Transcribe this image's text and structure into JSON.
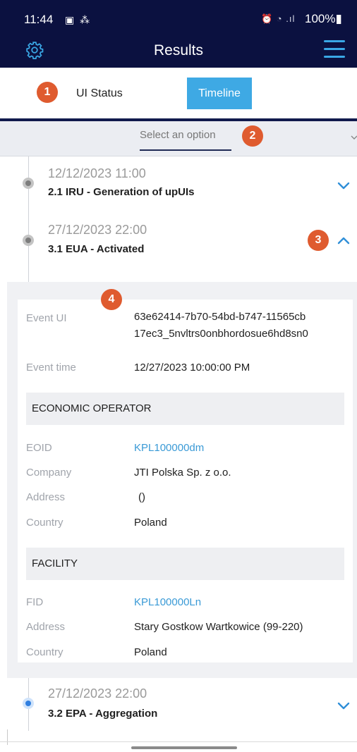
{
  "status_bar": {
    "time": "11:44",
    "left_icons": "▣ ⁂",
    "right_icons": "⏰ ◔ .ıl",
    "battery": "100%▮"
  },
  "header": {
    "title": "Results",
    "settings_icon": "gear-icon",
    "menu_icon": "hamburger-icon"
  },
  "tabs": {
    "ui_status_label": "UI Status",
    "timeline_label": "Timeline"
  },
  "badges": [
    "1",
    "2",
    "3",
    "4"
  ],
  "filter": {
    "placeholder": "Select an option"
  },
  "events": [
    {
      "date": "12/12/2023 11:00",
      "title": "2.1 IRU - Generation of upUIs",
      "expanded": false
    },
    {
      "date": "27/12/2023 22:00",
      "title": "3.1 EUA - Activated",
      "expanded": true
    },
    {
      "date": "27/12/2023 22:00",
      "title": "3.2 EPA - Aggregation",
      "expanded": false
    }
  ],
  "detail": {
    "event_ui_label": "Event UI",
    "event_ui_line1": "63e62414-7b70-54bd-b747-11565cb",
    "event_ui_line2": "17ec3_5nvltrs0onbhordosue6hd8sn0",
    "event_time_label": "Event time",
    "event_time_value": "12/27/2023 10:00:00 PM",
    "economic_operator": {
      "heading": "ECONOMIC OPERATOR",
      "eoid_label": "EOID",
      "eoid_value": "KPL100000dm",
      "company_label": "Company",
      "company_value": "JTI Polska Sp. z o.o.",
      "address_label": "Address",
      "address_value": "()",
      "country_label": "Country",
      "country_value": "Poland"
    },
    "facility": {
      "heading": "FACILITY",
      "fid_label": "FID",
      "fid_value": "KPL100000Ln",
      "address_label": "Address",
      "address_value": "Stary Gostkow Wartkowice (99-220)",
      "country_label": "Country",
      "country_value": "Poland"
    }
  },
  "colors": {
    "header_bg": "#0b1140",
    "accent": "#3ea9e4",
    "badge": "#df5b2f",
    "link": "#3a9ad6"
  }
}
